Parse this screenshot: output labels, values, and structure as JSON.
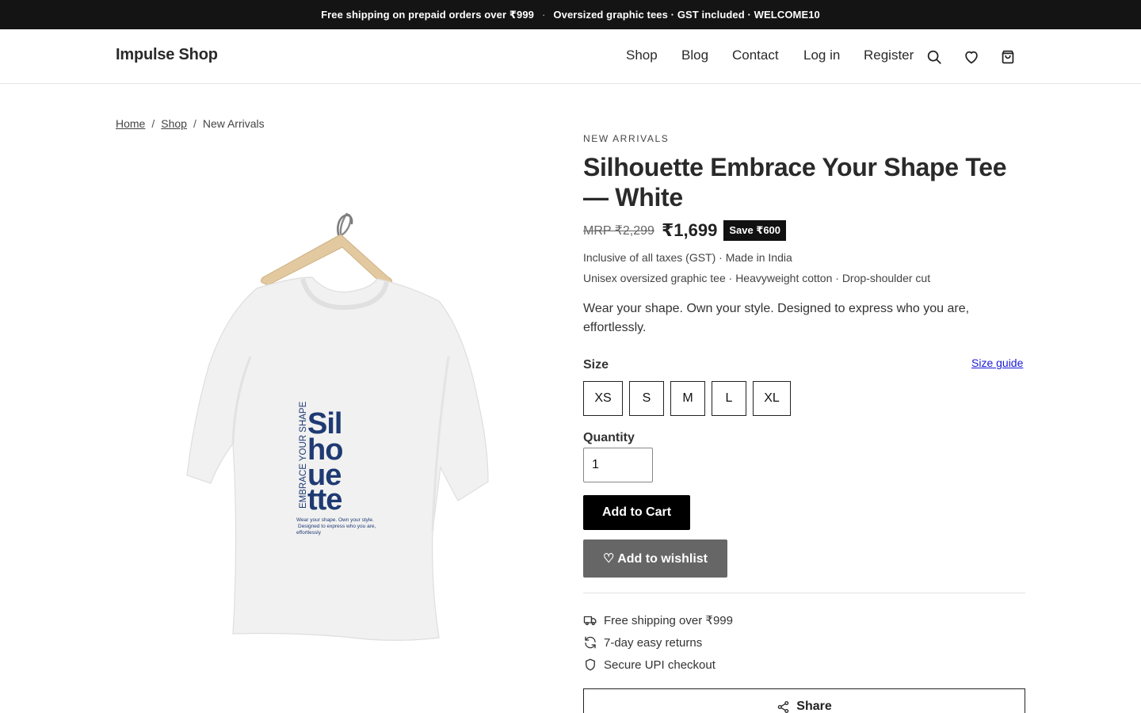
{
  "announcement": {
    "part1": "Free shipping on prepaid orders over ₹999",
    "separator": "·",
    "part2": "Oversized graphic tees · GST included · WELCOME10"
  },
  "header": {
    "logo": "Impulse Shop",
    "nav": [
      "Shop",
      "Blog",
      "Contact",
      "Log in",
      "Register"
    ],
    "icons": [
      "search-icon",
      "heart-icon",
      "cart-icon"
    ]
  },
  "breadcrumb": {
    "home": "Home",
    "shop": "Shop",
    "current": "New Arrivals",
    "separator": "/"
  },
  "product": {
    "eyebrow": "NEW ARRIVALS",
    "title": "Silhouette Embrace Your Shape Tee — White",
    "mrp": "MRP ₹2,299",
    "price": "₹1,699",
    "save_badge": "Save ₹600",
    "tax_note": "Inclusive of all taxes (GST) · Made in India",
    "spec_note": "Unisex oversized graphic tee · Heavyweight cotton · Drop-shoulder cut",
    "description": "Wear your shape. Own your style. Designed to express who you are, effortlessly.",
    "size_label": "Size",
    "size_guide": "Size guide",
    "sizes": [
      "XS",
      "S",
      "M",
      "L",
      "XL"
    ],
    "quantity_label": "Quantity",
    "quantity": "1",
    "add_to_cart": "Add to Cart",
    "add_to_wishlist": "♡ Add to wishlist",
    "perks": [
      "Free shipping over ₹999",
      "7-day easy returns",
      "Secure UPI checkout"
    ],
    "share": "Share"
  },
  "tee_print": {
    "vertical_text": "EMBRACE YOUR SHAPE",
    "lines": [
      "Sil",
      "ho",
      "ue",
      "tte"
    ],
    "tagline": [
      "Wear your shape. Own your style.",
      "Designed to express who you are,",
      "effortlessly"
    ],
    "ink_color": "#1f3a73"
  },
  "colors": {
    "announcement_bg": "#141414",
    "primary_button": "#000000",
    "secondary_button": "#666666",
    "link": "#1a1ad6"
  }
}
